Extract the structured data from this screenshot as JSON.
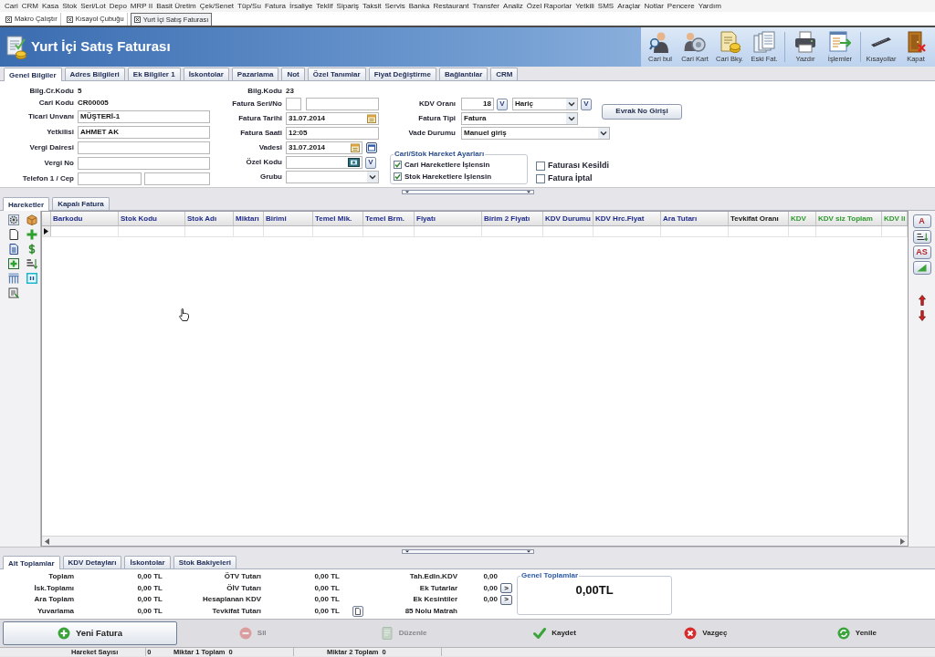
{
  "menu": [
    "Cari",
    "CRM",
    "Kasa",
    "Stok",
    "Seri/Lot",
    "Depo",
    "MRP II",
    "Basit Üretim",
    "Çek/Senet",
    "Tüp/Su",
    "Fatura",
    "İrsaliye",
    "Teklif",
    "Sipariş",
    "Taksit",
    "Servis",
    "Banka",
    "Restaurant",
    "Transfer",
    "Analiz",
    "Özel Raporlar",
    "Yetkili",
    "SMS",
    "Araçlar",
    "Notlar",
    "Pencere",
    "Yardım"
  ],
  "mdi_tabs": [
    {
      "label": "Makro Çalıştır",
      "selected": false
    },
    {
      "label": "Kısayol Çubuğu",
      "selected": false
    },
    {
      "label": "Yurt İçi Satış Faturası",
      "selected": true
    }
  ],
  "window": {
    "title": "Yurt İçi Satış Faturası"
  },
  "toolbar_groups": [
    [
      {
        "label": "Cari bul",
        "kind": "find"
      },
      {
        "label": "Cari Kart",
        "kind": "card"
      },
      {
        "label": "Cari Bky.",
        "kind": "balance"
      },
      {
        "label": "Eski Fat.",
        "kind": "archive"
      }
    ],
    [
      {
        "label": "Yazdır",
        "kind": "print"
      },
      {
        "label": "İşlemler",
        "kind": "actions"
      }
    ],
    [
      {
        "label": "Kısayollar",
        "kind": "shortcuts"
      },
      {
        "label": "Kapat",
        "kind": "close"
      }
    ]
  ],
  "form_tabs": [
    {
      "label": "Genel Bilgiler",
      "selected": true
    },
    {
      "label": "Adres Bilgileri",
      "selected": false
    },
    {
      "label": "Ek Bilgiler 1",
      "selected": false
    },
    {
      "label": "İskontolar",
      "selected": false
    },
    {
      "label": "Pazarlama",
      "selected": false
    },
    {
      "label": "Not",
      "selected": false
    },
    {
      "label": "Özel Tanımlar",
      "selected": false
    },
    {
      "label": "Fiyat Değiştirme",
      "selected": false
    },
    {
      "label": "Bağlantılar",
      "selected": false
    },
    {
      "label": "CRM",
      "selected": false
    }
  ],
  "form": {
    "left": [
      {
        "kind": "text",
        "label": "Bilg.Cr.Kodu",
        "value": "5"
      },
      {
        "kind": "text",
        "label": "Cari Kodu",
        "value": "CR00005"
      },
      {
        "kind": "input",
        "label": "Ticari Unvanı",
        "value": "MÜŞTERİ-1"
      },
      {
        "kind": "input",
        "label": "Yetkilisi",
        "value": "AHMET AK"
      },
      {
        "kind": "input",
        "label": "Vergi Dairesi"
      },
      {
        "kind": "input",
        "label": "Vergi No"
      },
      {
        "kind": "pair",
        "label": "Telefon 1 / Cep"
      }
    ],
    "middle": [
      {
        "kind": "text",
        "label": "Bilg.Kodu",
        "value": "23"
      },
      {
        "kind": "pair",
        "label": "Fatura Seri/No"
      },
      {
        "kind": "date",
        "label": "Fatura Tarihi",
        "value": "31.07.2014"
      },
      {
        "kind": "input",
        "label": "Fatura Saati",
        "value": "12:05"
      },
      {
        "kind": "date-button",
        "label": "Vadesi",
        "value": "31.07.2014"
      },
      {
        "kind": "lookup",
        "label": "Özel Kodu",
        "button": "V"
      },
      {
        "kind": "select",
        "label": "Grubu"
      }
    ],
    "right": [
      {
        "kind": "rate",
        "label": "KDV Oranı",
        "value": "18",
        "rate_button": "V",
        "select": "Hariç",
        "select_button": "V"
      },
      {
        "kind": "select",
        "label": "Fatura Tipi",
        "value": "Fatura"
      },
      {
        "kind": "select",
        "label": "Vade Durumu",
        "value": "Manuel giriş"
      }
    ],
    "entry_button": "Evrak No Girişi",
    "settings_group": {
      "title": "Cari/Stok Hareket Ayarları",
      "options": [
        {
          "label": "Cari Hareketlere İşlensin",
          "checked": true
        },
        {
          "label": "Stok Hareketlere İşlensin",
          "checked": true
        }
      ]
    },
    "flags": [
      {
        "label": "Faturası Kesildi",
        "checked": false
      },
      {
        "label": "Fatura İptal",
        "checked": false
      }
    ]
  },
  "detail_tabs": [
    {
      "label": "Hareketler",
      "selected": true
    },
    {
      "label": "Kapalı Fatura",
      "selected": false
    }
  ],
  "grid": {
    "columns": [
      {
        "label": "Barkodu",
        "color": "#1f2b8c"
      },
      {
        "label": "Stok Kodu",
        "color": "#1f2b8c"
      },
      {
        "label": "Stok Adı",
        "color": "#1f2b8c"
      },
      {
        "label": "Miktarı",
        "color": "#1f2b8c"
      },
      {
        "label": "Birimi",
        "color": "#1f2b8c"
      },
      {
        "label": "Temel Mik.",
        "color": "#1f2b8c"
      },
      {
        "label": "Temel Brm.",
        "color": "#1f2b8c"
      },
      {
        "label": "Fiyatı",
        "color": "#1f2b8c"
      },
      {
        "label": "Birim 2 Fiyatı",
        "color": "#1f2b8c"
      },
      {
        "label": "KDV Durumu",
        "color": "#1f2b8c"
      },
      {
        "label": "KDV Hrc.Fiyat",
        "color": "#1f2b8c"
      },
      {
        "label": "Ara Tutarı",
        "color": "#1f2b8c"
      },
      {
        "label": "Tevkifat Oranı",
        "color": "#1a1a1a"
      },
      {
        "label": "KDV",
        "color": "#2e9a2e"
      },
      {
        "label": "KDV siz Toplam",
        "color": "#2e9a2e"
      },
      {
        "label": "KDV li",
        "color": "#2e9a2e"
      }
    ]
  },
  "grid_tools": [
    {
      "kind": "text",
      "label": "A"
    },
    {
      "kind": "sort"
    },
    {
      "kind": "text",
      "label": "AS"
    },
    {
      "kind": "chart"
    }
  ],
  "summary_tabs": [
    {
      "label": "Alt Toplamlar",
      "selected": true
    },
    {
      "label": "KDV Detayları",
      "selected": false
    },
    {
      "label": "İskontolar",
      "selected": false
    },
    {
      "label": "Stok Bakiyeleri",
      "selected": false
    }
  ],
  "totals": {
    "columns": [
      [
        {
          "label": "Toplam",
          "value": "0,00 TL"
        },
        {
          "label": "İsk.Toplamı",
          "value": "0,00 TL"
        },
        {
          "label": "Ara Toplam",
          "value": "0,00 TL"
        },
        {
          "label": "Yuvarlama",
          "value": "0,00 TL"
        }
      ],
      [
        {
          "label": "ÖTV Tutarı",
          "value": "0,00 TL"
        },
        {
          "label": "ÖİV Tutarı",
          "value": "0,00 TL"
        },
        {
          "label": "Hesaplanan KDV",
          "value": "0,00 TL"
        },
        {
          "label": "Tevkifat Tutarı",
          "value": "0,00 TL"
        }
      ],
      [
        {
          "kind": "value",
          "label": "Tah.Edln.KDV",
          "value": "0,00"
        },
        {
          "kind": "button",
          "label": "Ek Tutarlar",
          "value": "0,00",
          "button": ">"
        },
        {
          "kind": "button",
          "label": "Ek Kesintiler",
          "value": "0,00",
          "button": ">"
        },
        {
          "kind": "icon",
          "label": "85 Nolu Matrah"
        }
      ]
    ]
  },
  "grand_total": {
    "title": "Genel Toplamlar",
    "value": "0,00TL"
  },
  "actions": [
    {
      "label": "Yeni Fatura",
      "kind": "new",
      "disabled": false,
      "focused": true
    },
    {
      "label": "Sil",
      "kind": "delete",
      "disabled": true,
      "focused": false
    },
    {
      "label": "Düzenle",
      "kind": "edit",
      "disabled": true,
      "focused": false
    },
    {
      "label": "Kaydet",
      "kind": "save",
      "disabled": false,
      "focused": false
    },
    {
      "label": "Vazgeç",
      "kind": "cancel",
      "disabled": false,
      "focused": false
    },
    {
      "label": "Yenile",
      "kind": "refresh",
      "disabled": false,
      "focused": false
    }
  ],
  "status_bar": [
    {
      "label": "Hareket Sayısı",
      "value": "0"
    },
    {
      "label": "Miktar 1 Toplam",
      "value": "0"
    },
    {
      "label": "Miktar 2 Toplam",
      "value": "0"
    }
  ]
}
